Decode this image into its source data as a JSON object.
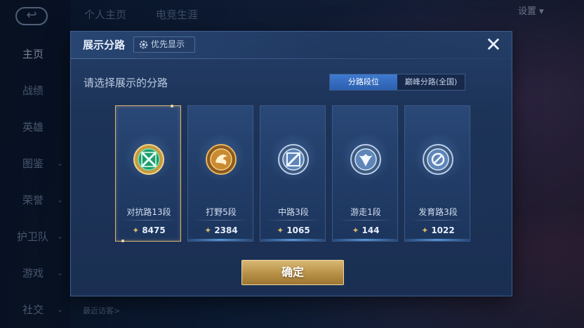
{
  "background": {
    "nav_tabs": [
      "个人主页",
      "电竞生涯"
    ],
    "settings_label": "设置",
    "sidebar": [
      {
        "label": "主页",
        "active": true
      },
      {
        "label": "战绩"
      },
      {
        "label": "英雄"
      },
      {
        "label": "图鉴"
      },
      {
        "label": "荣誉"
      },
      {
        "label": "护卫队"
      },
      {
        "label": "游戏"
      },
      {
        "label": "社交"
      }
    ],
    "recent_visitors_label": "最近访客>"
  },
  "modal": {
    "title": "展示分路",
    "priority_label": "优先显示",
    "close_icon": "close-icon",
    "prompt": "请选择展示的分路",
    "tabs": [
      {
        "label": "分路段位",
        "active": true
      },
      {
        "label": "巅峰分路(全国)",
        "active": false
      }
    ],
    "lanes": [
      {
        "name": "对抗路13段",
        "score": "8475",
        "selected": true,
        "color": "#2fbf8a"
      },
      {
        "name": "打野5段",
        "score": "2384",
        "selected": false,
        "color": "#d8a445"
      },
      {
        "name": "中路3段",
        "score": "1065",
        "selected": false,
        "color": "#8fb6e0"
      },
      {
        "name": "游走1段",
        "score": "144",
        "selected": false,
        "color": "#8fb6e0"
      },
      {
        "name": "发育路3段",
        "score": "1022",
        "selected": false,
        "color": "#8fb6e0"
      }
    ],
    "confirm_label": "确定"
  },
  "colors": {
    "accent_gold": "#d9b77b",
    "tab_active": "#3f7bd0",
    "panel": "#1d3459"
  }
}
